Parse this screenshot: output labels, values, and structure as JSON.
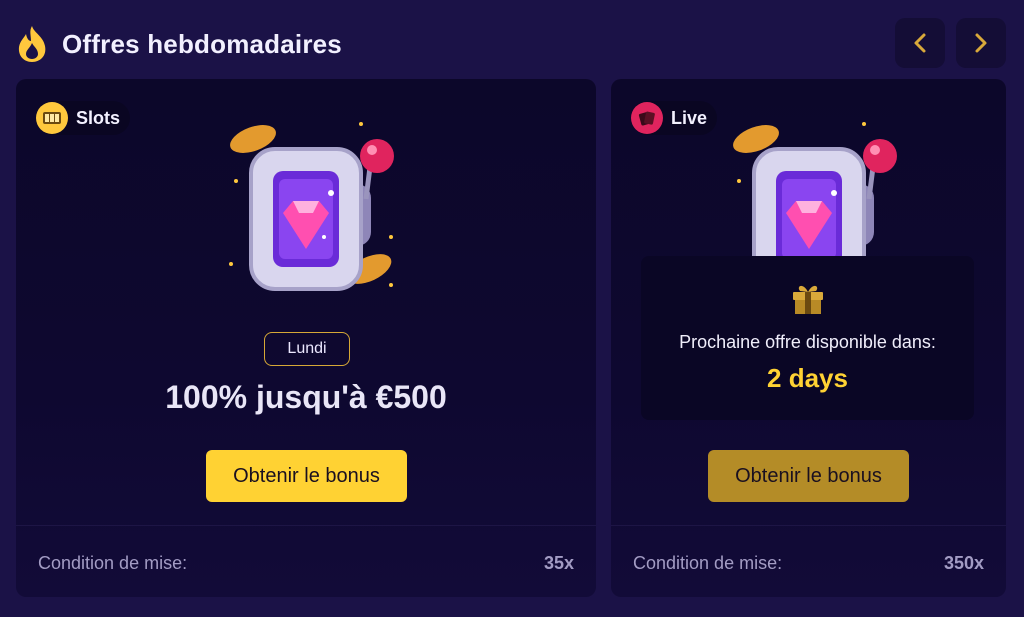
{
  "header": {
    "title": "Offres hebdomadaires",
    "icon": "flame-icon",
    "accent": "#ffc83d"
  },
  "nav": {
    "prev_icon": "chevron-left-icon",
    "next_icon": "chevron-right-icon"
  },
  "cards": [
    {
      "category": "Slots",
      "category_icon": "slot-machine-icon",
      "day": "Lundi",
      "offer": "100% jusqu'à €500",
      "cta": "Obtenir le bonus",
      "wager_label": "Condition de mise:",
      "wager_value": "35x"
    },
    {
      "category": "Live",
      "category_icon": "playing-cards-icon",
      "countdown_label": "Prochaine offre disponible dans:",
      "countdown_value": "2 days",
      "cta": "Obtenir le bonus",
      "wager_label": "Condition de mise:",
      "wager_value": "350x"
    }
  ],
  "colors": {
    "background": "#1b1247",
    "card": "#0c072a",
    "cta_active": "#ffd233",
    "cta_disabled": "#b48c27",
    "gold": "#d6a836"
  }
}
